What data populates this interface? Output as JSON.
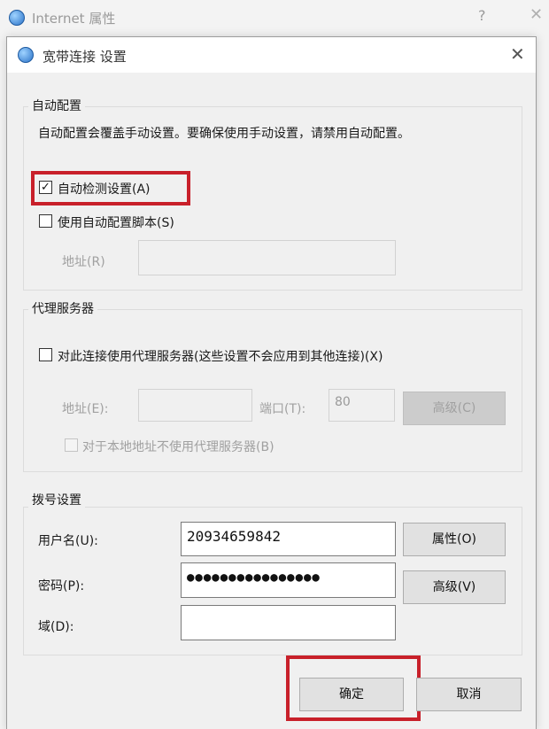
{
  "background_window": {
    "title": "Internet 属性",
    "help_glyph": "?",
    "close_glyph": "✕"
  },
  "dialog": {
    "title": "宽带连接 设置",
    "close_glyph": "✕"
  },
  "auto_config": {
    "legend": "自动配置",
    "description": "自动配置会覆盖手动设置。要确保使用手动设置，请禁用自动配置。",
    "auto_detect": {
      "label": "自动检测设置(A)",
      "checked": true,
      "highlight_color": "#c8202a"
    },
    "use_script": {
      "label": "使用自动配置脚本(S)",
      "checked": false
    },
    "address_label": "地址(R)",
    "address_value": ""
  },
  "proxy": {
    "legend": "代理服务器",
    "use_proxy": {
      "label": "对此连接使用代理服务器(这些设置不会应用到其他连接)(X)",
      "checked": false
    },
    "address_label": "地址(E):",
    "address_value": "",
    "port_label": "端口(T):",
    "port_value": "80",
    "advanced_button": "高级(C)",
    "bypass_local": {
      "label": "对于本地地址不使用代理服务器(B)",
      "checked": false
    }
  },
  "dialup": {
    "legend": "拨号设置",
    "username_label": "用户名(U):",
    "username_value": "20934659842",
    "password_label": "密码(P):",
    "password_value": "●●●●●●●●●●●●●●●●",
    "domain_label": "域(D):",
    "domain_value": "",
    "properties_button": "属性(O)",
    "advanced_button": "高级(V)"
  },
  "footer": {
    "ok_button": "确定",
    "cancel_button": "取消",
    "ok_highlight_color": "#c8202a"
  }
}
